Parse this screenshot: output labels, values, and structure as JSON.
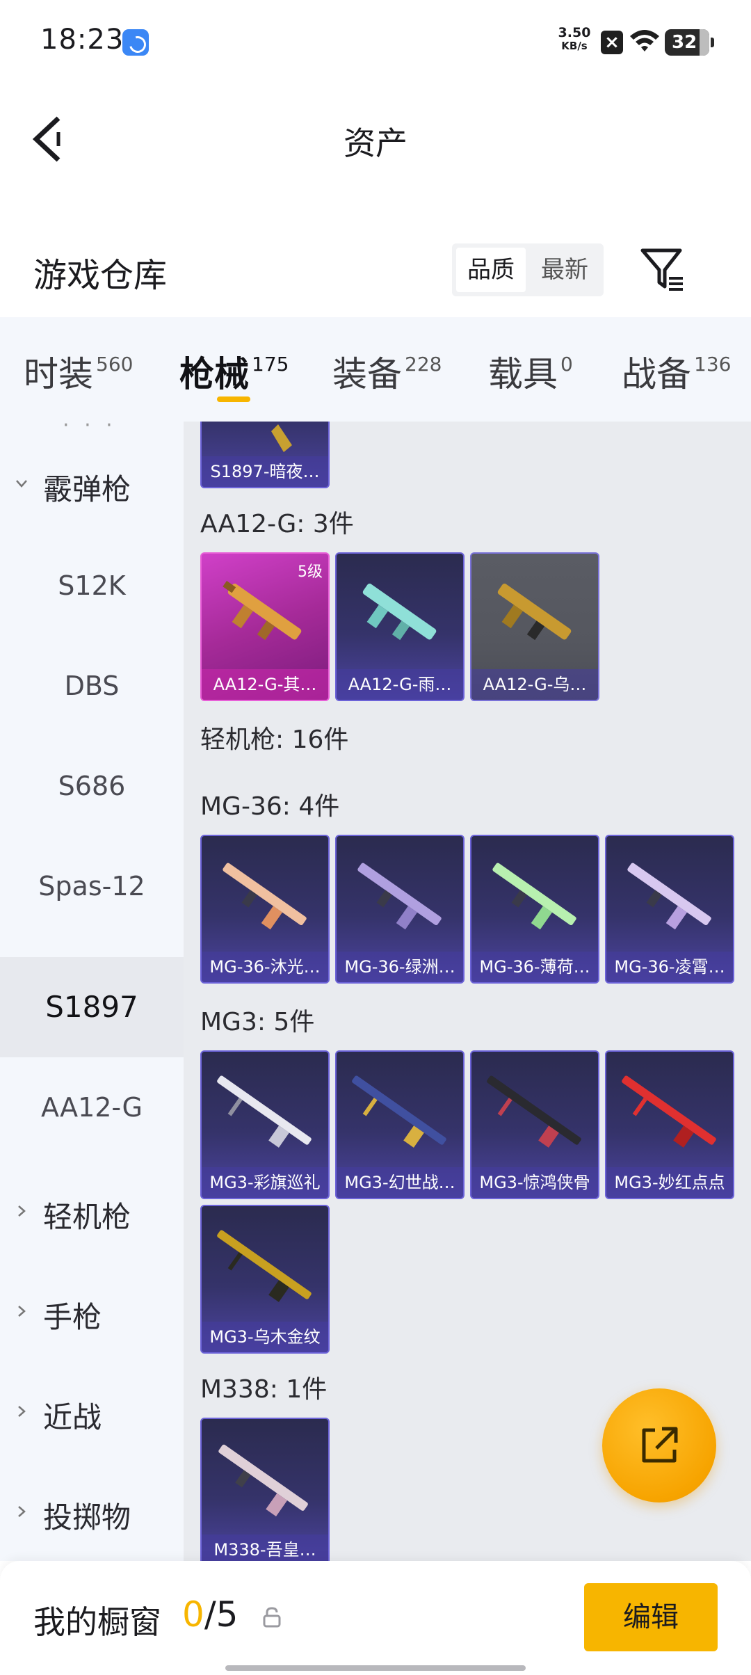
{
  "status_bar": {
    "time": "18:23",
    "speed_value": "3.50",
    "speed_unit": "KB/s",
    "battery": "32"
  },
  "header": {
    "title": "资产"
  },
  "warehouse": {
    "title": "游戏仓库",
    "sort_options": [
      "品质",
      "最新"
    ],
    "active_sort": "品质"
  },
  "tabs": [
    {
      "label": "时装",
      "count": "560"
    },
    {
      "label": "枪械",
      "count": "175"
    },
    {
      "label": "装备",
      "count": "228"
    },
    {
      "label": "载具",
      "count": "0"
    },
    {
      "label": "战备",
      "count": "136"
    }
  ],
  "active_tab": "枪械",
  "sidenav": {
    "items": [
      {
        "type": "group",
        "label": "霰弹枪"
      },
      {
        "type": "sub",
        "label": "S12K"
      },
      {
        "type": "sub",
        "label": "DBS"
      },
      {
        "type": "sub",
        "label": "S686"
      },
      {
        "type": "sub",
        "label": "Spas-12"
      },
      {
        "type": "sub",
        "label": "S1897",
        "active": true
      },
      {
        "type": "sub",
        "label": "AA12-G"
      },
      {
        "type": "group",
        "label": "轻机枪"
      },
      {
        "type": "group",
        "label": "手枪"
      },
      {
        "type": "group",
        "label": "近战"
      },
      {
        "type": "group",
        "label": "投掷物"
      }
    ]
  },
  "content": {
    "top_partial_card": {
      "name": "S1897-暗夜…"
    },
    "sections": [
      {
        "title": "AA12-G: 3件"
      },
      {
        "title": "轻机枪: 16件"
      },
      {
        "title": "MG-36: 4件"
      },
      {
        "title": "MG3: 5件"
      },
      {
        "title": "M338: 1件"
      }
    ],
    "aa12_cards": [
      {
        "name": "AA12-G-其…",
        "level": "5级",
        "style": "gold-purple",
        "gun_color": "#e0a040"
      },
      {
        "name": "AA12-G-雨…",
        "style": "purple",
        "gun_color": "#8fe0d8"
      },
      {
        "name": "AA12-G-乌…",
        "style": "gray",
        "gun_color": "#c89a30"
      }
    ],
    "mg36_cards": [
      {
        "name": "MG-36-沐光…",
        "gun_color": "#f0c0a0"
      },
      {
        "name": "MG-36-绿洲…",
        "gun_color": "#b0a0e0"
      },
      {
        "name": "MG-36-薄荷…",
        "gun_color": "#b8f0b0"
      },
      {
        "name": "MG-36-凌霄…",
        "gun_color": "#d8c8f0"
      }
    ],
    "mg3_cards": [
      {
        "name": "MG3-彩旗巡礼",
        "gun_color": "#e8e8f0"
      },
      {
        "name": "MG3-幻世战…",
        "gun_color": "#d8b040"
      },
      {
        "name": "MG3-惊鸿侠骨",
        "gun_color": "#c04050"
      },
      {
        "name": "MG3-妙红点点",
        "gun_color": "#e03030"
      },
      {
        "name": "MG3-乌木金纹",
        "gun_color": "#c8a020"
      }
    ],
    "m338_cards": [
      {
        "name": "M338-吾皇…",
        "gun_color": "#e0d0d8"
      }
    ]
  },
  "bottom_bar": {
    "label": "我的橱窗",
    "current": "0",
    "separator": "/",
    "total": "5",
    "edit_label": "编辑"
  },
  "colors": {
    "accent": "#f7b500",
    "card_border": "#6c63d8",
    "sidebar_bg": "#f4f7fc",
    "content_bg": "#e9ebef"
  }
}
